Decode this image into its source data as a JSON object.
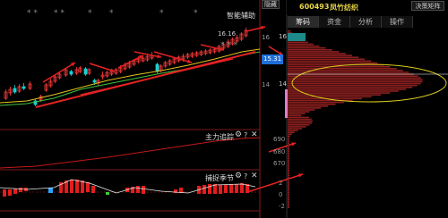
{
  "header": {
    "return_label": "隐藏",
    "stock_code": "600493",
    "stock_name": "凤竹纺织",
    "decision_label": "决策矩阵"
  },
  "tabs": [
    {
      "label": "筹码",
      "active": true
    },
    {
      "label": "资金",
      "active": false
    },
    {
      "label": "分析",
      "active": false
    },
    {
      "label": "操作",
      "active": false
    }
  ],
  "main_chart": {
    "indicator_label": "智能辅助",
    "high_label": "16.16",
    "stars_top": [
      "* *",
      "* *",
      "*",
      "*",
      "*",
      "*"
    ],
    "stars_bottom": "* * *"
  },
  "price_axis": {
    "ticks": [
      "16",
      "15.31",
      "14"
    ],
    "current_price": "15.31",
    "accent": "#1e6fd9"
  },
  "sub1": {
    "label": "主力追踪",
    "ticks": [
      "690",
      "680",
      "670"
    ]
  },
  "sub2": {
    "label": "捕捉季节",
    "ticks": [
      "2",
      "0",
      "-2"
    ]
  },
  "chip_axis": {
    "tick_top": "16",
    "tick_mid": "14"
  },
  "colors": {
    "up": "#ff3b3b",
    "down": "#19d1d1",
    "arrow": "#e22222",
    "yellow": "#d8cc1c",
    "chip": "#8c1f1f"
  },
  "icons": [
    "gear-icon",
    "help-icon",
    "close-icon"
  ]
}
